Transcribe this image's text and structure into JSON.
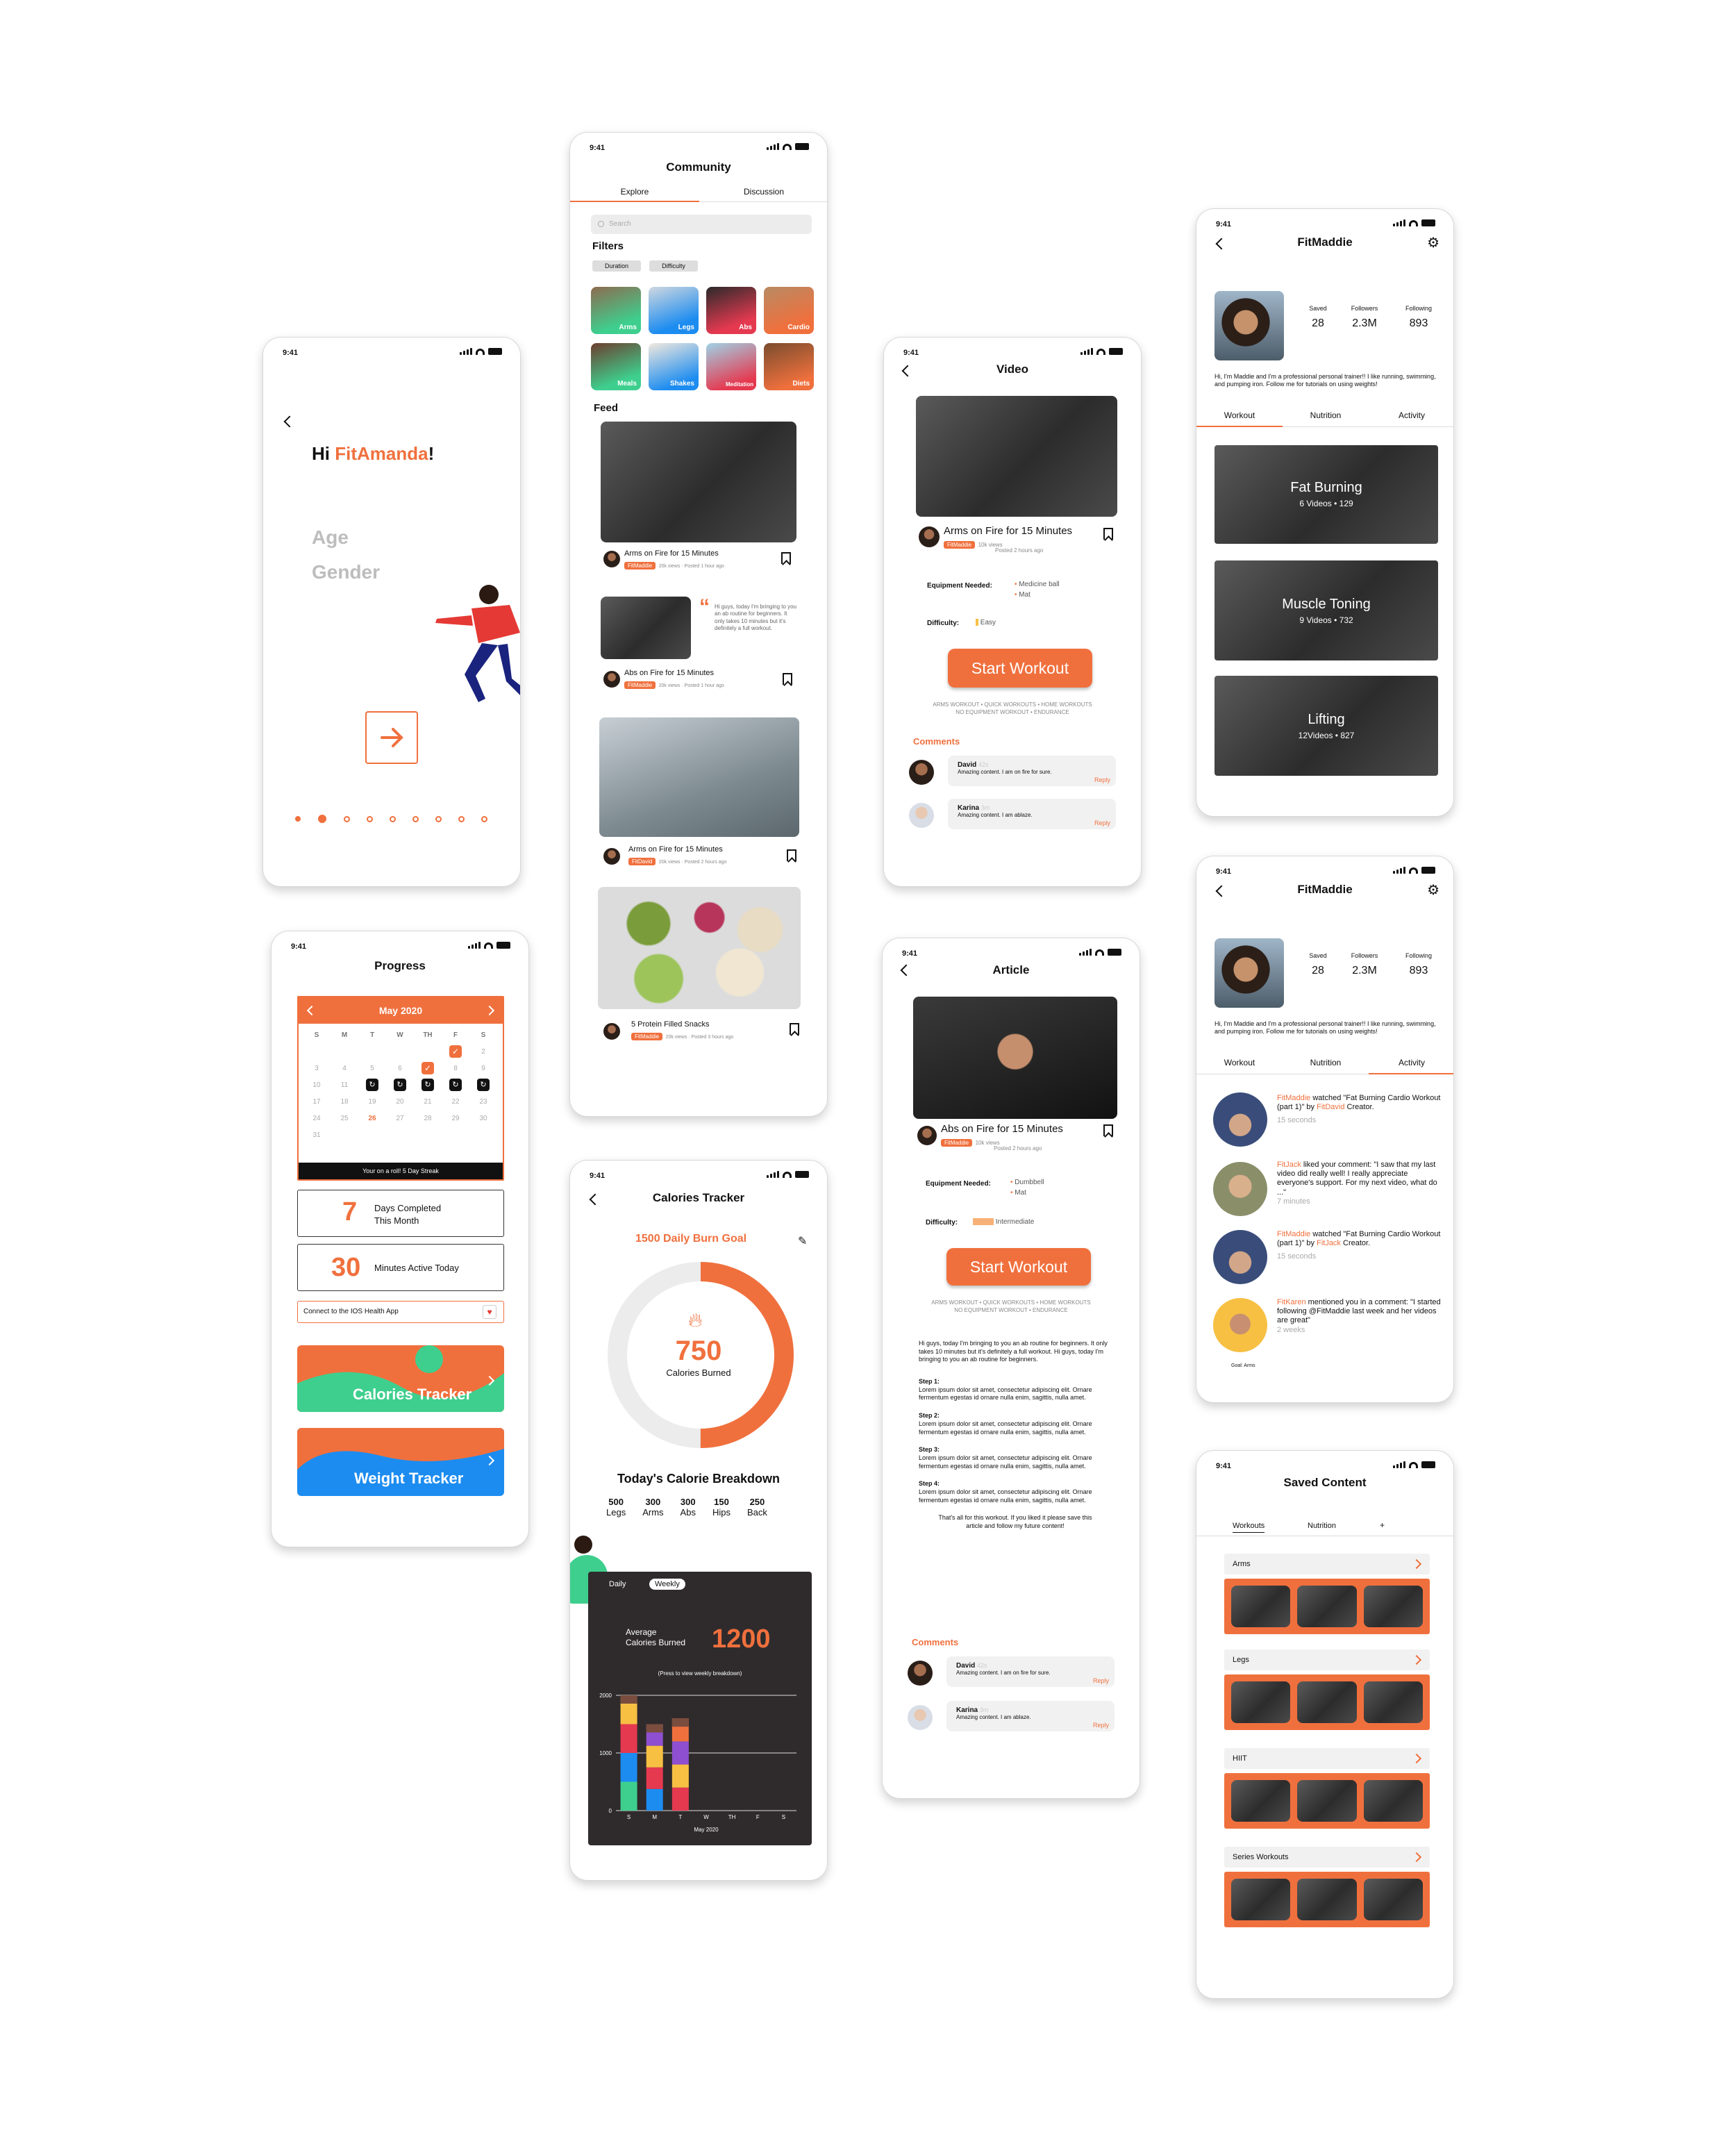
{
  "status_time": "9:41",
  "welcome": {
    "hi": "Hi ",
    "name": "FitAmanda",
    "excl": "!",
    "age_label": "Age",
    "gender_label": "Gender"
  },
  "progress": {
    "title": "Progress",
    "month": "May 2020",
    "weekdays": [
      "S",
      "M",
      "T",
      "W",
      "TH",
      "F",
      "S"
    ],
    "streak_text": "Your on a roll! 5 Day Streak",
    "days_completed_value": "7",
    "days_completed_label1": "Days Completed",
    "days_completed_label2": "This Month",
    "minutes_value": "30",
    "minutes_label": "Minutes Active Today",
    "health_label": "Connect to the IOS Health App",
    "calories_tracker": "Calories Tracker",
    "weight_tracker": "Weight Tracker"
  },
  "community": {
    "title": "Community",
    "tab_explore": "Explore",
    "tab_discussion": "Discussion",
    "search_placeholder": "Search",
    "filters_title": "Filters",
    "filter_duration": "Duration",
    "filter_difficulty": "Difficulty",
    "categories": [
      "Arms",
      "Legs",
      "Abs",
      "Cardio",
      "Meals",
      "Shakes",
      "Meditation",
      "Diets"
    ],
    "feed_title": "Feed",
    "post1_title": "Arms on Fire for 15 Minutes",
    "post1_author": "FitMaddie",
    "post1_meta": "20k views · Posted 1 hour ago",
    "post2_title": "Abs on Fire for 15 Minutes",
    "post2_author": "FitMaddie",
    "post2_meta": "20k views · Posted 1 hour ago",
    "post2_quote": "Hi guys, today I'm bringing to you an ab routine for beginners. It only takes 10 minutes but it's definitely a full workout.",
    "post3_title": "Arms on Fire for 15 Minutes",
    "post3_author": "FitDavid",
    "post3_meta": "20k views · Posted 2 hours ago",
    "post4_title": "5 Protein Filled Snacks",
    "post4_author": "FitMaddie",
    "post4_meta": "20k views · Posted 3 hours ago"
  },
  "calories": {
    "title": "Calories Tracker",
    "goal": "1500 Daily Burn Goal",
    "value": "750",
    "value_label": "Calories Burned",
    "breakdown_title": "Today's Calorie Breakdown",
    "breakdown": [
      {
        "value": "500",
        "label": "Legs"
      },
      {
        "value": "300",
        "label": "Arms"
      },
      {
        "value": "300",
        "label": "Abs"
      },
      {
        "value": "150",
        "label": "Hips"
      },
      {
        "value": "250",
        "label": "Back"
      }
    ],
    "toggle_daily": "Daily",
    "toggle_weekly": "Weekly",
    "avg_label1": "Average",
    "avg_label2": "Calories Burned",
    "avg_value": "1200",
    "press_hint": "(Press to view weekly breakdown)",
    "chart_month": "May 2020"
  },
  "chart_data": {
    "type": "bar",
    "categories": [
      "S",
      "M",
      "T",
      "W",
      "TH",
      "F",
      "S"
    ],
    "ylim": [
      0,
      2000
    ],
    "yticks": [
      "2000",
      "1000",
      "0"
    ],
    "values": [
      2000,
      1500,
      1600,
      0,
      0,
      0,
      0
    ],
    "xlabel": "May 2020"
  },
  "video": {
    "title": "Video",
    "workout_title": "Arms on Fire for 15 Minutes",
    "author": "FitMaddie",
    "meta1": "10k views",
    "meta2": "Posted 2 hours ago",
    "equipment_label": "Equipment Needed:",
    "equipment": [
      "Medicine ball",
      "Mat"
    ],
    "difficulty_label": "Difficulty:",
    "difficulty": "Easy",
    "start": "Start Workout",
    "tags": "ARMS WORKOUT • QUICK WORKOUTS • HOME WORKOUTS",
    "tags2": "NO EQUIPMENT WORKOUT • ENDURANCE",
    "comments_title": "Comments",
    "c1_name": "David",
    "c1_time": "42s",
    "c1_text": "Amazing content. I am on fire for sure.",
    "c2_name": "Karina",
    "c2_time": "3m",
    "c2_text": "Amazing content. I am ablaze.",
    "reply": "Reply"
  },
  "article": {
    "title": "Article",
    "workout_title": "Abs on Fire for 15 Minutes",
    "author": "FitMaddie",
    "meta1": "10k views",
    "meta2": "Posted 2 hours ago",
    "equipment_label": "Equipment Needed:",
    "equipment": [
      "Dumbbell",
      "Mat"
    ],
    "difficulty_label": "Difficulty:",
    "difficulty": "Intermediate",
    "start": "Start Workout",
    "tags": "ARMS WORKOUT • QUICK WORKOUTS • HOME WORKOUTS",
    "tags2": "NO EQUIPMENT WORKOUT • ENDURANCE",
    "intro": "Hi guys, today I'm bringing to you an ab routine for beginners. It only takes 10 minutes but it's definitely a full workout. Hi guys, today I'm bringing to you an ab routine for beginners.",
    "steps": [
      {
        "label": "Step 1:",
        "text": "Lorem ipsum dolor sit amet, consectetur adipiscing elit. Ornare fermentum egestas id ornare nulla enim, sagittis, nulla amet."
      },
      {
        "label": "Step 2:",
        "text": "Lorem ipsum dolor sit amet, consectetur adipiscing elit. Ornare fermentum egestas id ornare nulla enim, sagittis, nulla amet."
      },
      {
        "label": "Step 3:",
        "text": "Lorem ipsum dolor sit amet, consectetur adipiscing elit. Ornare fermentum egestas id ornare nulla enim, sagittis, nulla amet."
      },
      {
        "label": "Step 4:",
        "text": "Lorem ipsum dolor sit amet, consectetur adipiscing elit. Ornare fermentum egestas id ornare nulla enim, sagittis, nulla amet."
      }
    ],
    "outro": "That's all for this workout. If you liked it please save this article and follow my future content!",
    "comments_title": "Comments",
    "c1_name": "David",
    "c1_time": "42s",
    "c1_text": "Amazing content. I am on fire for sure.",
    "c2_name": "Karina",
    "c2_time": "3m",
    "c2_text": "Amazing content. I am ablaze.",
    "reply": "Reply"
  },
  "profile": {
    "title": "FitMaddie",
    "saved_label": "Saved",
    "saved": "28",
    "followers_label": "Followers",
    "followers": "2.3M",
    "following_label": "Following",
    "following": "893",
    "bio": "Hi, I'm Maddie and I'm a professional personal trainer!! I like running, swimming, and pumping iron. Follow me for tutorials on using weights!",
    "tab_workout": "Workout",
    "tab_nutrition": "Nutrition",
    "tab_activity": "Activity",
    "cards": [
      {
        "title": "Fat Burning",
        "meta": "6 Videos • 129"
      },
      {
        "title": "Muscle Toning",
        "meta": "9 Videos • 732"
      },
      {
        "title": "Lifting",
        "meta": "12Videos • 827"
      }
    ]
  },
  "activity": {
    "items": [
      {
        "user": "FitMaddie",
        "text": " watched \"Fat Burning Cardio Workout (part 1)\" by ",
        "target": "FitDavid",
        "tail": " Creator.",
        "time": "15 seconds"
      },
      {
        "user": "FitJack",
        "text": " liked your comment: \"I saw that my last video did really well! I really appreciate everyone's support. For my next video, what do ...\"",
        "target": "",
        "tail": "",
        "time": "7 minutes"
      },
      {
        "user": "FitMaddie",
        "text": " watched \"Fat Burning Cardio Workout (part 1)\" by ",
        "target": "FitJack",
        "tail": " Creator.",
        "time": "15 seconds"
      },
      {
        "user": "FitKaren",
        "text": " mentioned you in a comment: \"I started following @FitMaddie last week and her videos are great\"",
        "target": "",
        "tail": "",
        "time": "2 weeks"
      }
    ],
    "goal": "Goal: Arms"
  },
  "saved": {
    "title": "Saved Content",
    "tab_workouts": "Workouts",
    "tab_nutrition": "Nutrition",
    "tab_add": "+",
    "groups": [
      "Arms",
      "Legs",
      "HIIT",
      "Series Workouts"
    ]
  }
}
